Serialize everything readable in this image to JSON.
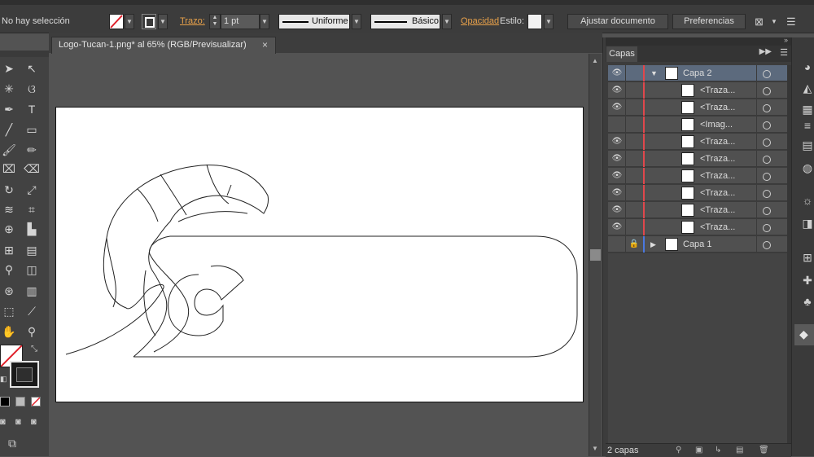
{
  "control_bar": {
    "selection_status": "No hay selección",
    "stroke_label": "Trazo:",
    "stroke_weight": "1 pt",
    "stroke_profile": "Uniforme",
    "brush": "Básico",
    "opacity_label": "Opacidad",
    "style_label": "Estilo:",
    "adjust_document_button": "Ajustar documento",
    "preferences_button": "Preferencias"
  },
  "document": {
    "tab_title": "Logo-Tucan-1.png* al 65% (RGB/Previsualizar)",
    "close_glyph": "×"
  },
  "layers_panel": {
    "tab_label": "Capas",
    "rows": [
      {
        "name": "Capa 2",
        "visible": true,
        "expanded": true,
        "level": 0,
        "selected": true,
        "color": "#e0474c"
      },
      {
        "name": "<Traza...",
        "visible": true,
        "level": 1,
        "color": "#e0474c"
      },
      {
        "name": "<Traza...",
        "visible": true,
        "level": 1,
        "color": "#e0474c"
      },
      {
        "name": "<Imag...",
        "visible": false,
        "level": 1,
        "color": "#e0474c"
      },
      {
        "name": "<Traza...",
        "visible": true,
        "level": 1,
        "color": "#e0474c"
      },
      {
        "name": "<Traza...",
        "visible": true,
        "level": 1,
        "color": "#e0474c"
      },
      {
        "name": "<Traza...",
        "visible": true,
        "level": 1,
        "color": "#e0474c"
      },
      {
        "name": "<Traza...",
        "visible": true,
        "level": 1,
        "color": "#e0474c"
      },
      {
        "name": "<Traza...",
        "visible": true,
        "level": 1,
        "color": "#e0474c"
      },
      {
        "name": "<Traza...",
        "visible": true,
        "level": 1,
        "color": "#e0474c"
      },
      {
        "name": "Capa 1",
        "visible": false,
        "locked": true,
        "expanded": false,
        "level": 0,
        "color": "#4a78e0"
      }
    ],
    "footer_count": "2 capas"
  },
  "colors": {
    "accent_orange": "#e8a14a",
    "layer2_color": "#e0474c",
    "layer1_color": "#4a78e0",
    "selection_row": "#5c6a7d"
  }
}
